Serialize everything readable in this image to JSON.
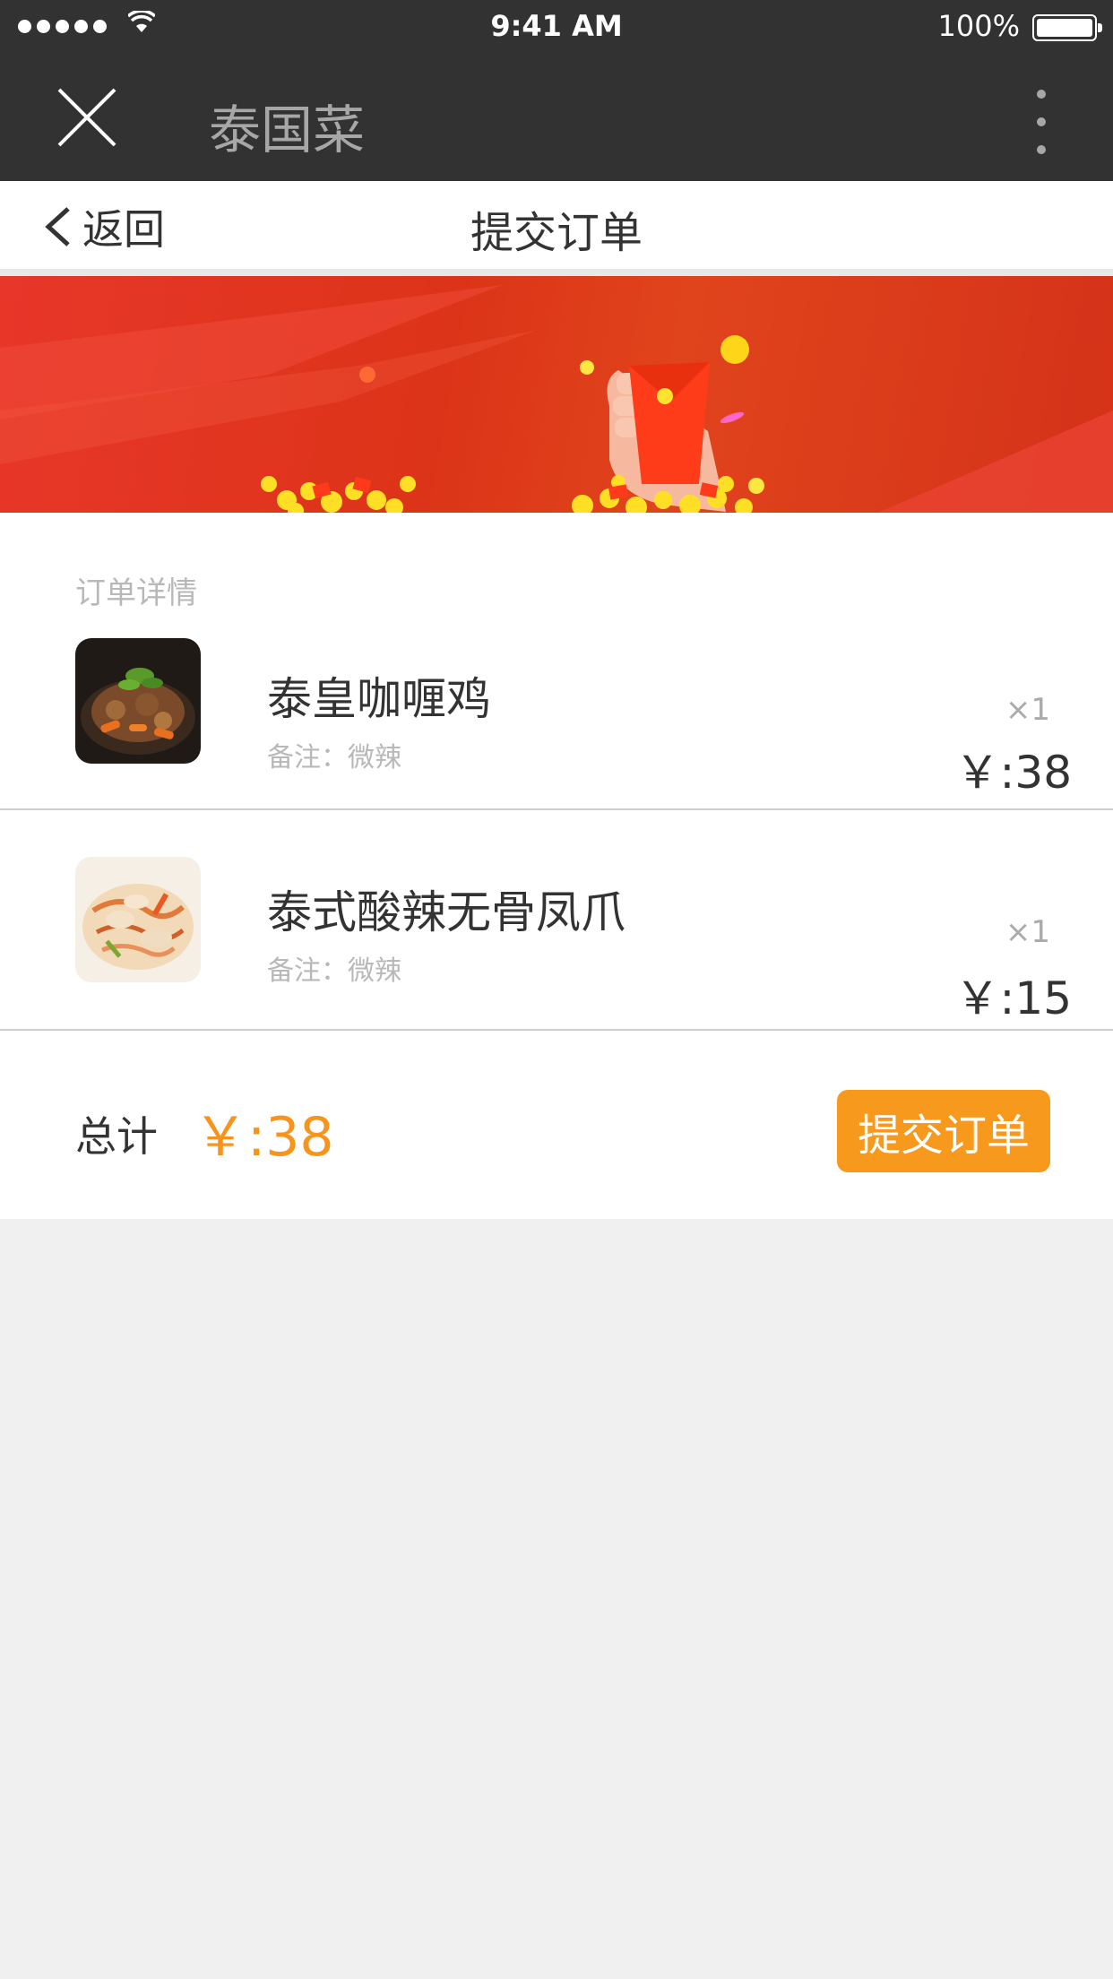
{
  "status_bar": {
    "time": "9:41 AM",
    "battery": "100%"
  },
  "app": {
    "title": "泰国菜"
  },
  "nav": {
    "back_label": "返回",
    "title": "提交订单"
  },
  "order": {
    "section_title": "订单详情",
    "items": [
      {
        "name": "泰皇咖喱鸡",
        "note": "备注：微辣",
        "qty": "×1",
        "price": "￥:38"
      },
      {
        "name": "泰式酸辣无骨凤爪",
        "note": "备注：微辣",
        "qty": "×1",
        "price": "￥:15"
      }
    ],
    "total_label": "总计",
    "total_value": "￥:38",
    "submit_label": "提交订单"
  },
  "colors": {
    "top_bar": "#323232",
    "accent_orange": "#f7991c",
    "banner_red": "#dc3418",
    "background": "#f0f0f0"
  },
  "icons": {
    "close": "close-icon",
    "more": "more-vertical-icon",
    "back": "chevron-left-icon"
  }
}
